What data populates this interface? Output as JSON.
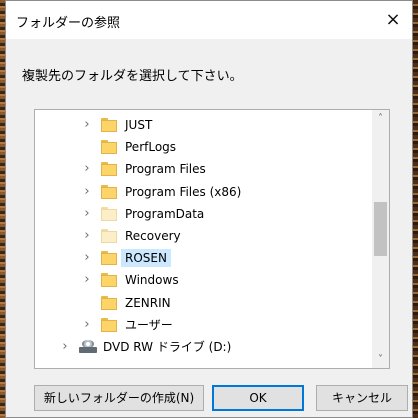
{
  "dialog": {
    "title": "フォルダーの参照",
    "close_glyph": "×",
    "prompt": "複製先のフォルダを選択して下さい。"
  },
  "tree": {
    "items": [
      {
        "label": "JUST",
        "expand": true,
        "icon": "folder-icon",
        "indent": 1
      },
      {
        "label": "PerfLogs",
        "expand": false,
        "icon": "folder-icon",
        "indent": 1
      },
      {
        "label": "Program Files",
        "expand": true,
        "icon": "folder-icon",
        "indent": 1
      },
      {
        "label": "Program Files (x86)",
        "expand": true,
        "icon": "folder-icon",
        "indent": 1
      },
      {
        "label": "ProgramData",
        "expand": true,
        "icon": "folder-faded-icon",
        "indent": 1
      },
      {
        "label": "Recovery",
        "expand": true,
        "icon": "folder-faded-icon",
        "indent": 1
      },
      {
        "label": "ROSEN",
        "expand": true,
        "icon": "folder-icon",
        "indent": 1,
        "selected": true
      },
      {
        "label": "Windows",
        "expand": true,
        "icon": "folder-icon",
        "indent": 1
      },
      {
        "label": "ZENRIN",
        "expand": false,
        "icon": "folder-icon",
        "indent": 1
      },
      {
        "label": "ユーザー",
        "expand": true,
        "icon": "folder-icon",
        "indent": 1
      },
      {
        "label": "DVD RW ドライブ (D:)",
        "expand": true,
        "icon": "dvd-drive-icon",
        "indent": 0
      }
    ],
    "chevron_glyph": "›",
    "scroll_up_glyph": "˄",
    "scroll_down_glyph": "˅"
  },
  "buttons": {
    "new_folder": "新しいフォルダーの作成(N)",
    "ok": "OK",
    "cancel": "キャンセル"
  },
  "colors": {
    "selection": "#cce8ff",
    "default_button_border": "#0078d7",
    "folder": "#fcd468"
  }
}
